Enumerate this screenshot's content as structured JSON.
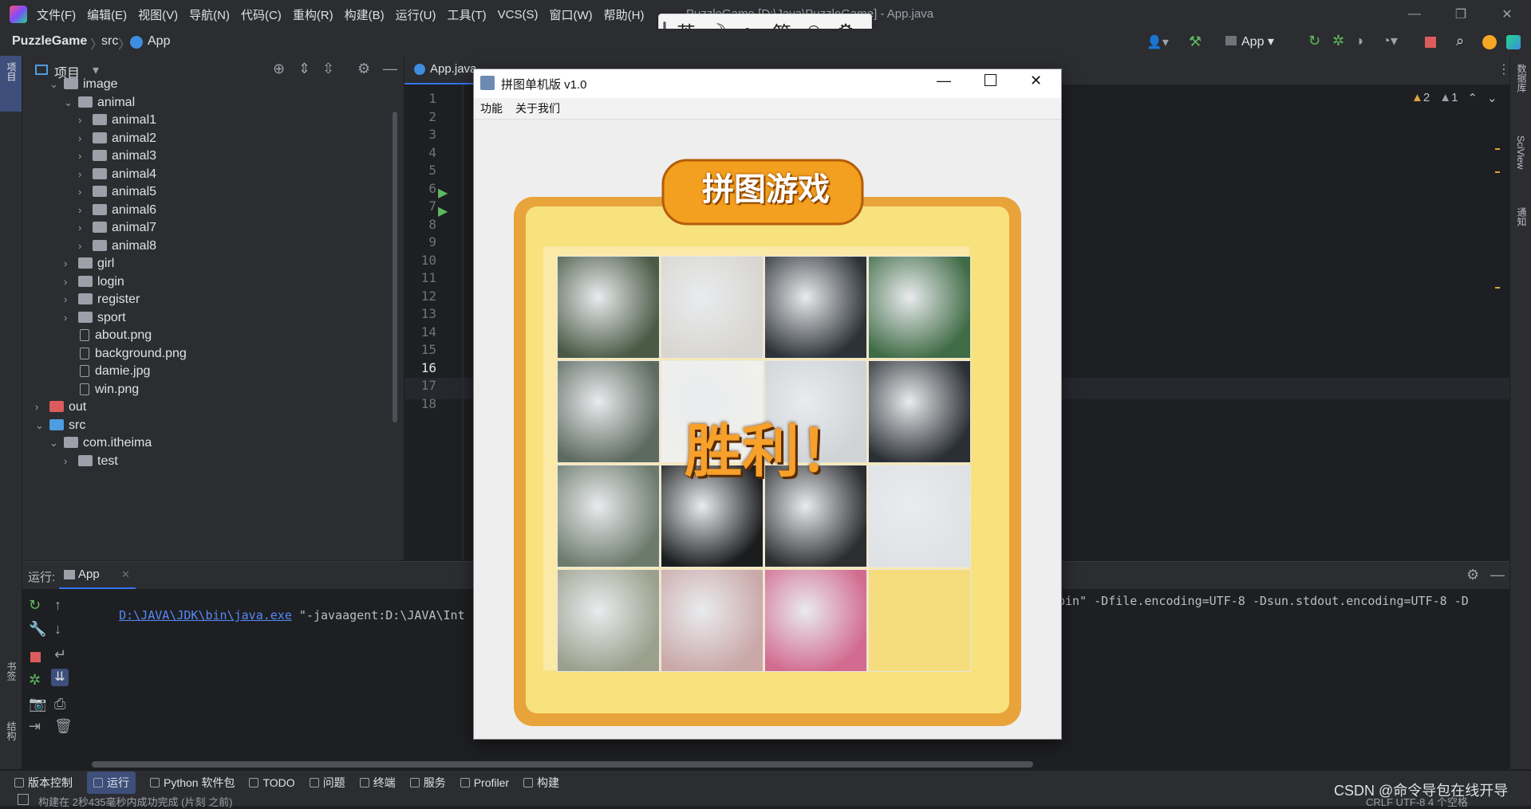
{
  "menu": [
    "文件(F)",
    "编辑(E)",
    "视图(V)",
    "导航(N)",
    "代码(C)",
    "重构(R)",
    "构建(B)",
    "运行(U)",
    "工具(T)",
    "VCS(S)",
    "窗口(W)",
    "帮助(H)"
  ],
  "window_title": "PuzzleGame [D:\\Java\\PuzzleGame] - App.java",
  "breadcrumb": {
    "project": "PuzzleGame",
    "folder": "src",
    "file": "App"
  },
  "run_config": "App",
  "ime": {
    "lang": "英",
    "simp": "简"
  },
  "project_panel": {
    "title": "项目",
    "tree": [
      {
        "label": "image",
        "type": "folder",
        "level": 1,
        "expanded": true
      },
      {
        "label": "animal",
        "type": "folder",
        "level": 2,
        "expanded": true
      },
      {
        "label": "animal1",
        "type": "folder",
        "level": 3,
        "expanded": false
      },
      {
        "label": "animal2",
        "type": "folder",
        "level": 3,
        "expanded": false
      },
      {
        "label": "animal3",
        "type": "folder",
        "level": 3,
        "expanded": false
      },
      {
        "label": "animal4",
        "type": "folder",
        "level": 3,
        "expanded": false
      },
      {
        "label": "animal5",
        "type": "folder",
        "level": 3,
        "expanded": false
      },
      {
        "label": "animal6",
        "type": "folder",
        "level": 3,
        "expanded": false
      },
      {
        "label": "animal7",
        "type": "folder",
        "level": 3,
        "expanded": false
      },
      {
        "label": "animal8",
        "type": "folder",
        "level": 3,
        "expanded": false
      },
      {
        "label": "girl",
        "type": "folder",
        "level": 2,
        "expanded": false
      },
      {
        "label": "login",
        "type": "folder",
        "level": 2,
        "expanded": false
      },
      {
        "label": "register",
        "type": "folder",
        "level": 2,
        "expanded": false
      },
      {
        "label": "sport",
        "type": "folder",
        "level": 2,
        "expanded": false
      },
      {
        "label": "about.png",
        "type": "file",
        "level": 2
      },
      {
        "label": "background.png",
        "type": "file",
        "level": 2
      },
      {
        "label": "damie.jpg",
        "type": "file",
        "level": 2
      },
      {
        "label": "win.png",
        "type": "file",
        "level": 2
      },
      {
        "label": "out",
        "type": "folder-red",
        "level": 0,
        "expanded": false
      },
      {
        "label": "src",
        "type": "folder-blue",
        "level": 0,
        "expanded": true
      },
      {
        "label": "com.itheima",
        "type": "package",
        "level": 1,
        "expanded": true
      },
      {
        "label": "test",
        "type": "folder",
        "level": 2,
        "expanded": false
      }
    ]
  },
  "editor": {
    "tab_label": "App.java",
    "line_numbers": [
      "1",
      "2",
      "3",
      "4",
      "5",
      "6",
      "7",
      "8",
      "9",
      "10",
      "11",
      "12",
      "13",
      "14",
      "15",
      "16",
      "17",
      "18"
    ],
    "current_line": "16",
    "warnings": {
      "warn": "2",
      "weak": "1"
    }
  },
  "run_panel": {
    "label": "运行:",
    "tab": "App",
    "java_path": "D:\\JAVA\\JDK\\bin\\java.exe",
    "cmd_left": "\"-javaagent:D:\\JAVA\\Int",
    "cmd_right": "bin\" -Dfile.encoding=UTF-8 -Dsun.stdout.encoding=UTF-8 -D"
  },
  "bottom_tools": [
    {
      "icon": "vcs-icon",
      "label": "版本控制",
      "active": false
    },
    {
      "icon": "run-icon",
      "label": "运行",
      "active": true
    },
    {
      "icon": "python-packages-icon",
      "label": "Python 软件包",
      "active": false
    },
    {
      "icon": "todo-icon",
      "label": "TODO",
      "active": false
    },
    {
      "icon": "problems-icon",
      "label": "问题",
      "active": false
    },
    {
      "icon": "terminal-icon",
      "label": "终端",
      "active": false
    },
    {
      "icon": "services-icon",
      "label": "服务",
      "active": false
    },
    {
      "icon": "profiler-icon",
      "label": "Profiler",
      "active": false
    },
    {
      "icon": "build-icon",
      "label": "构建",
      "active": false
    }
  ],
  "status": {
    "message": "构建在 2秒435毫秒内成功完成 (片刻 之前)",
    "watermark": "CSDN @命令导包在线开导",
    "encoding": "CRLF   UTF-8   4 个空格"
  },
  "left_stripe": {
    "project": "项目",
    "bookmarks": "书签",
    "structure": "结构"
  },
  "right_stripe": {
    "database": "数据库",
    "sciview": "SciView",
    "notifications": "通知"
  },
  "swing_window": {
    "title": "拼图单机版 v1.0",
    "menu": [
      "功能",
      "关于我们"
    ],
    "game_title": "拼图游戏",
    "win_text": "胜利！"
  },
  "colors": {
    "accent": "#3574f0",
    "board_wood": "#e8a43a",
    "board_inner": "#f7e27e"
  }
}
